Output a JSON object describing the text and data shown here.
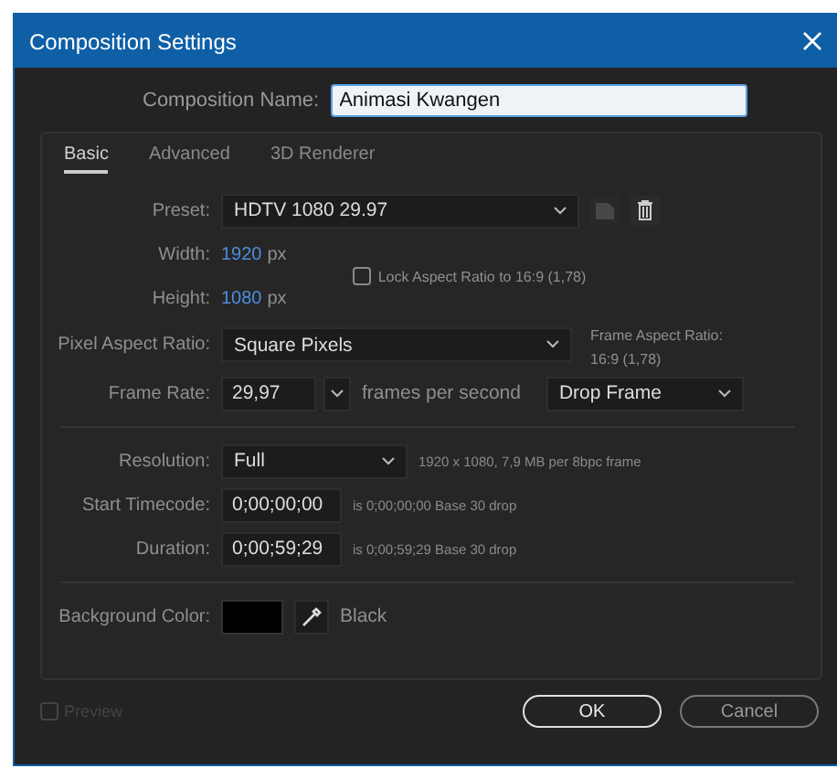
{
  "window": {
    "title": "Composition Settings"
  },
  "composition_name": {
    "label": "Composition Name:",
    "value": "Animasi Kwangen"
  },
  "tabs": [
    {
      "label": "Basic",
      "selected": true
    },
    {
      "label": "Advanced",
      "selected": false
    },
    {
      "label": "3D Renderer",
      "selected": false
    }
  ],
  "preset": {
    "label": "Preset:",
    "value": "HDTV 1080 29.97"
  },
  "width": {
    "label": "Width:",
    "value": "1920",
    "unit": "px"
  },
  "height": {
    "label": "Height:",
    "value": "1080",
    "unit": "px"
  },
  "lock_aspect": {
    "label": "Lock Aspect Ratio to 16:9 (1,78)",
    "checked": false
  },
  "pixel_aspect": {
    "label": "Pixel Aspect Ratio:",
    "value": "Square Pixels"
  },
  "frame_aspect": {
    "label": "Frame Aspect Ratio:",
    "value": "16:9 (1,78)"
  },
  "frame_rate": {
    "label": "Frame Rate:",
    "value": "29,97",
    "unit": "frames per second",
    "mode": "Drop Frame"
  },
  "resolution": {
    "label": "Resolution:",
    "value": "Full",
    "info": "1920 x 1080, 7,9 MB per 8bpc frame"
  },
  "start_timecode": {
    "label": "Start Timecode:",
    "value": "0;00;00;00",
    "info": "is 0;00;00;00  Base 30  drop"
  },
  "duration": {
    "label": "Duration:",
    "value": "0;00;59;29",
    "info": "is 0;00;59;29  Base 30  drop"
  },
  "background": {
    "label": "Background Color:",
    "color": "#000000",
    "name": "Black"
  },
  "preview": {
    "label": "Preview",
    "checked": false,
    "disabled": true
  },
  "buttons": [
    {
      "label": "OK",
      "default": true
    },
    {
      "label": "Cancel",
      "default": false
    }
  ]
}
